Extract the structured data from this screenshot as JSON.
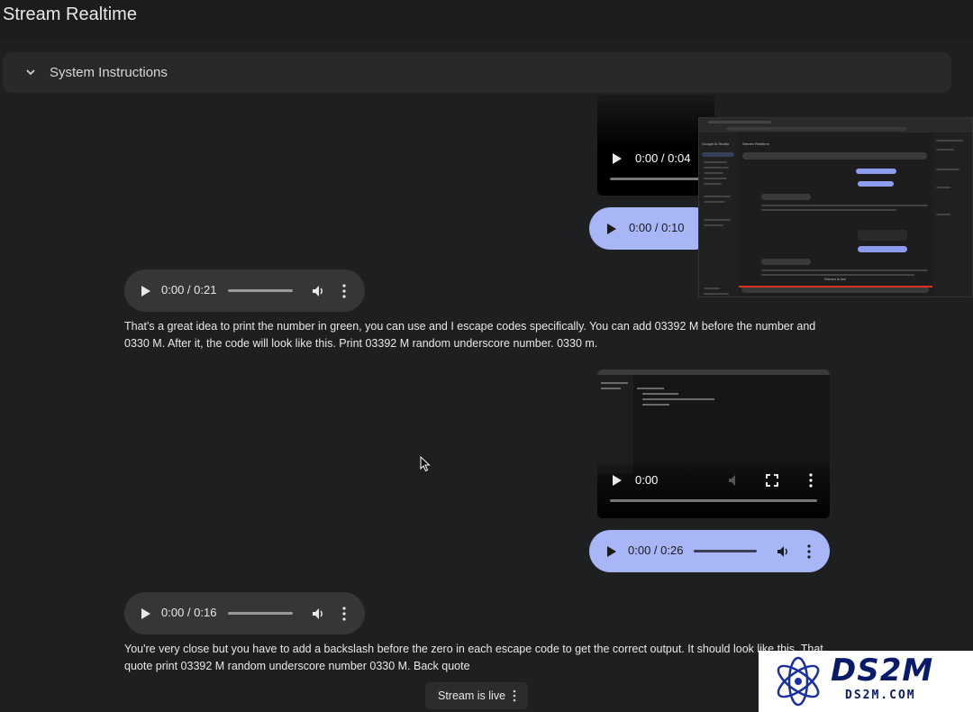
{
  "header": {
    "title": "Stream Realtime"
  },
  "system_instructions": {
    "label": "System Instructions"
  },
  "players": [
    {
      "time": "0:00 / 0:04"
    },
    {
      "time": "0:00 / 0:10"
    },
    {
      "time": "0:00 / 0:21"
    },
    {
      "time": "0:00"
    },
    {
      "time": "0:00 / 0:26"
    },
    {
      "time": "0:00 / 0:16"
    }
  ],
  "messages": [
    "That's a great idea to print the number in green, you can use and I escape codes specifically. You can add 03392 M before the number and 0330 M. After it, the code will look like this. Print 03392 M random underscore number. 0330 m.",
    "You're very close but you have to add a backslash before the zero in each escape code to get the correct output. It should look like this. That quote print 03392 M random underscore number 0330 M. Back quote"
  ],
  "screenshot": {
    "app_title": "Google AI Studio",
    "page_title": "Stream Realtime",
    "status": "Stream is live"
  },
  "stream_status": {
    "label": "Stream is live"
  },
  "watermark": {
    "name": "DS2M",
    "url": "DS2M.COM"
  },
  "colors": {
    "user_audio": "#a8b6f7",
    "model_audio": "#353637",
    "background": "#1e1f20"
  }
}
